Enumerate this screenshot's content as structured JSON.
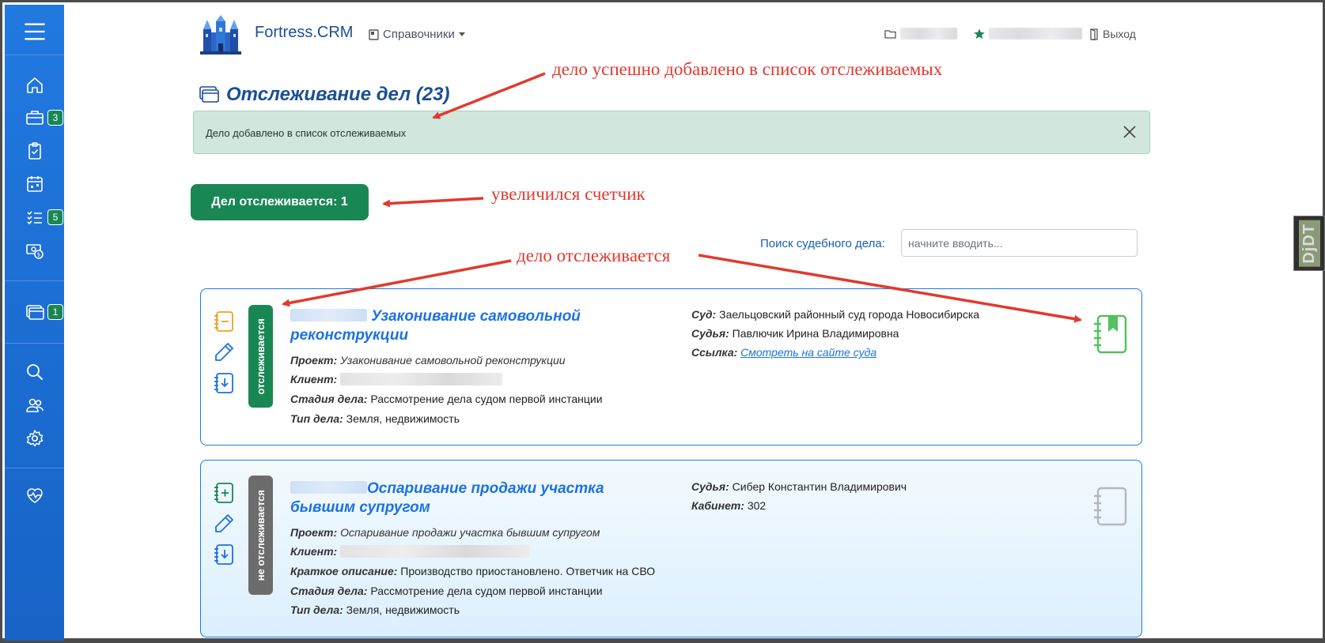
{
  "header": {
    "brand": "Fortress.CRM",
    "menu_reference": "Справочники",
    "logout": "Выход"
  },
  "sidebar": {
    "badges": {
      "briefcase": "3",
      "tasks": "5",
      "tracking": "1"
    }
  },
  "page": {
    "title": "Отслеживание дел (23)"
  },
  "alert": {
    "text": "Дело добавлено в список отслеживаемых"
  },
  "counter_button": "Дел отслеживается: 1",
  "search": {
    "label": "Поиск судебного дела:",
    "placeholder": "начните вводить..."
  },
  "cases": [
    {
      "status": "отслеживается",
      "title": "Узаконивание самовольной реконструкции",
      "project_label": "Проект:",
      "project": "Узаконивание самовольной реконструкции",
      "client_label": "Клиент:",
      "stage_label": "Стадия дела:",
      "stage": "Рассмотрение дела судом первой инстанции",
      "type_label": "Тип дела:",
      "type": "Земля, недвижимость",
      "court_label": "Суд:",
      "court": "Заельцовский районный суд города Новосибирска",
      "judge_label": "Судья:",
      "judge": "Павлючик Ирина Владимировна",
      "link_label": "Ссылка:",
      "link_text": "Смотреть на сайте суда"
    },
    {
      "status": "не отслеживается",
      "title": "Оспаривание продажи участка бывшим супругом",
      "project_label": "Проект:",
      "project": "Оспаривание продажи участка бывшим супругом",
      "client_label": "Клиент:",
      "summary_label": "Краткое описание:",
      "summary": "Производство приостановлено. Ответчик на СВО",
      "stage_label": "Стадия дела:",
      "stage": "Рассмотрение дела судом первой инстанции",
      "type_label": "Тип дела:",
      "type": "Земля, недвижимость",
      "judge_label": "Судья:",
      "judge": "Сибер Константин Владимирович",
      "office_label": "Кабинет:",
      "office": "302"
    }
  ],
  "annotations": {
    "added": "дело успешно добавлено в список отслеживаемых",
    "counter": "увеличился счетчик",
    "tracked": "дело отслеживается"
  },
  "debug_toolbar": "DjDT",
  "colors": {
    "sidebar": "#1e72d8",
    "brand": "#1a4f95",
    "success": "#198754",
    "link": "#1b72e3",
    "annotation": "#e03a2f",
    "alert_bg": "#d1e7dd"
  }
}
